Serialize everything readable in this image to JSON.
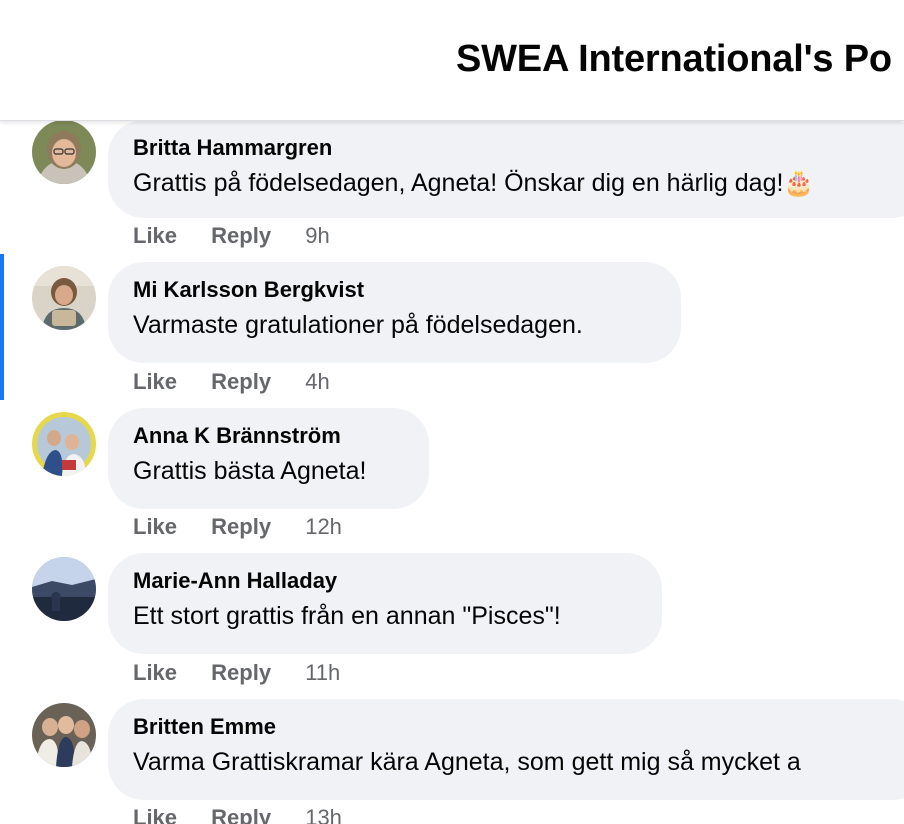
{
  "header": {
    "title": "SWEA International's Po"
  },
  "comments": [
    {
      "author": "Britta Hammargren",
      "text": "Grattis på födelsedagen, Agneta! Önskar dig en härlig dag!🎂",
      "like_label": "Like",
      "reply_label": "Reply",
      "time": "9h"
    },
    {
      "author": "Mi Karlsson Bergkvist",
      "text": "Varmaste gratulationer på födelsedagen.",
      "like_label": "Like",
      "reply_label": "Reply",
      "time": "4h"
    },
    {
      "author": "Anna K Brännström",
      "text": "Grattis bästa Agneta!",
      "like_label": "Like",
      "reply_label": "Reply",
      "time": "12h"
    },
    {
      "author": "Marie-Ann Halladay",
      "text": "Ett stort grattis från en annan \"Pisces\"!",
      "like_label": "Like",
      "reply_label": "Reply",
      "time": "11h"
    },
    {
      "author": "Britten Emme",
      "text": "Varma Grattiskramar kära Agneta, som gett mig så mycket a",
      "like_label": "Like",
      "reply_label": "Reply",
      "time": "13h"
    }
  ],
  "colors": {
    "accent": "#1877f2",
    "bubble": "#f0f2f5",
    "meta": "#65676b",
    "text": "#050505"
  }
}
